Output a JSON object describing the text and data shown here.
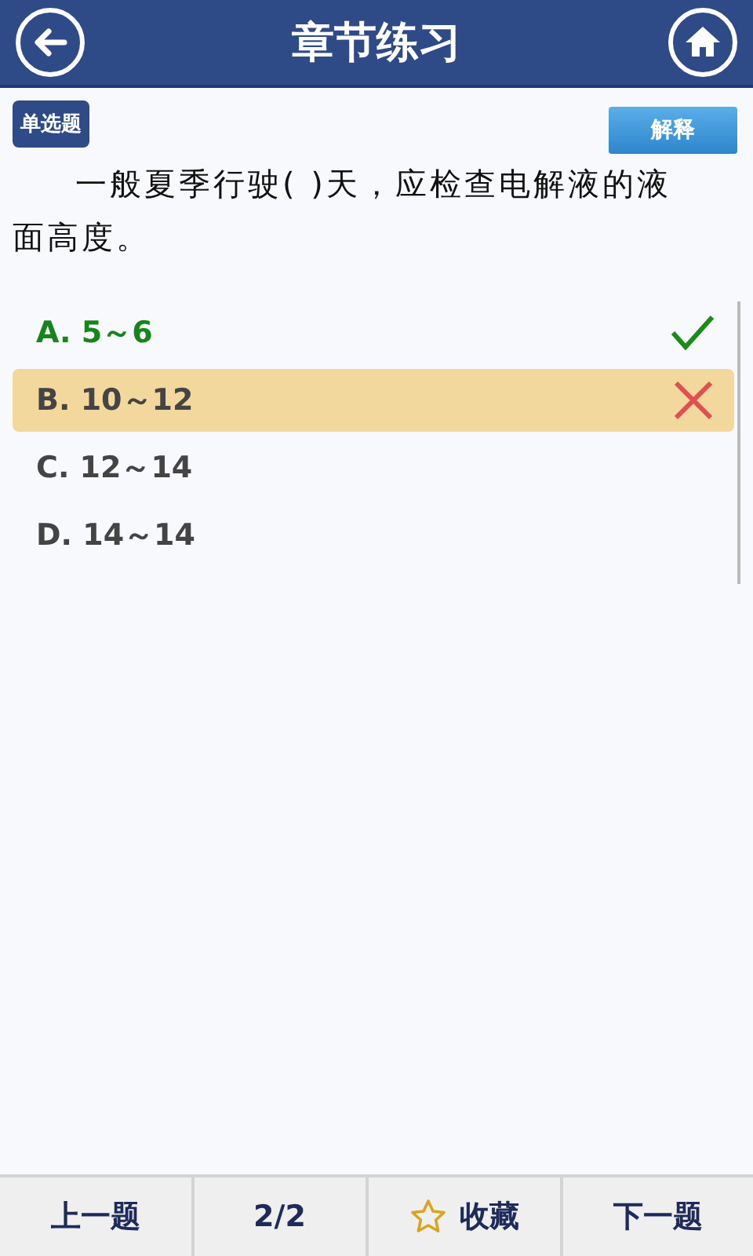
{
  "header": {
    "title": "章节练习"
  },
  "question": {
    "type_badge": "单选题",
    "explain_button": "解释",
    "text": "一般夏季行驶(  )天，应检查电解液的液面高度。"
  },
  "options": [
    {
      "label": "A. 5～6",
      "selected": false,
      "kind": "correct"
    },
    {
      "label": "B. 10～12",
      "selected": true,
      "kind": "wrong"
    },
    {
      "label": "C. 12～14",
      "selected": false,
      "kind": "plain"
    },
    {
      "label": "D. 14～14",
      "selected": false,
      "kind": "plain"
    }
  ],
  "bottom_bar": {
    "previous": "上一题",
    "progress": "2/2",
    "favorite": "收藏",
    "next": "下一题"
  }
}
